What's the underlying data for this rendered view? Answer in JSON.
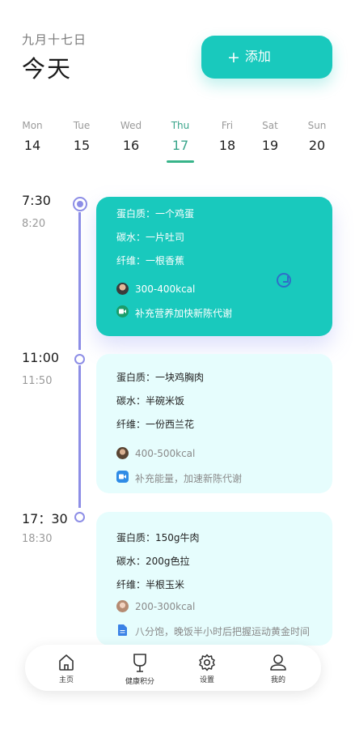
{
  "header": {
    "lunar_date": "九月十七日",
    "title": "今天"
  },
  "add_button": {
    "plus": "+",
    "label": "添加"
  },
  "week": [
    {
      "name": "Mon",
      "date": "14"
    },
    {
      "name": "Tue",
      "date": "15"
    },
    {
      "name": "Wed",
      "date": "16"
    },
    {
      "name": "Thu",
      "date": "17",
      "active": true
    },
    {
      "name": "Fri",
      "date": "18"
    },
    {
      "name": "Sat",
      "date": "19"
    },
    {
      "name": "Sun",
      "date": "20"
    }
  ],
  "meals": [
    {
      "start": "7:30",
      "end": "8:20",
      "protein": "蛋白质：一个鸡蛋",
      "carbs": "碳水：一片吐司",
      "fiber": "纤维：一根香蕉",
      "kcal": "300-400kcal",
      "note": "补充营养加快新陈代谢",
      "note_icon": "video-call-icon"
    },
    {
      "start": "11:00",
      "end": "11:50",
      "protein": "蛋白质：一块鸡胸肉",
      "carbs": "碳水：半碗米饭",
      "fiber": "纤维：一份西兰花",
      "kcal": "400-500kcal",
      "note": "补充能量，加速新陈代谢",
      "note_icon": "video-camera-icon"
    },
    {
      "start": "17：30",
      "end": "18:30",
      "protein": "蛋白质：150g牛肉",
      "carbs": "碳水：200g色拉",
      "fiber": "纤维：半根玉米",
      "kcal": "200-300kcal",
      "note": "八分饱，晚饭半小时后把握运动黄金时间",
      "note_icon": "document-icon"
    }
  ],
  "tabs": [
    {
      "label": "主页",
      "icon": "home-icon"
    },
    {
      "label": "健康积分",
      "icon": "trophy-icon"
    },
    {
      "label": "设置",
      "icon": "gear-icon"
    },
    {
      "label": "我的",
      "icon": "user-icon"
    }
  ],
  "colors": {
    "accent": "#19c9bd",
    "timeline": "#8d8ee6",
    "card_light": "#e6fdfd",
    "active_day": "#3aa58b"
  }
}
